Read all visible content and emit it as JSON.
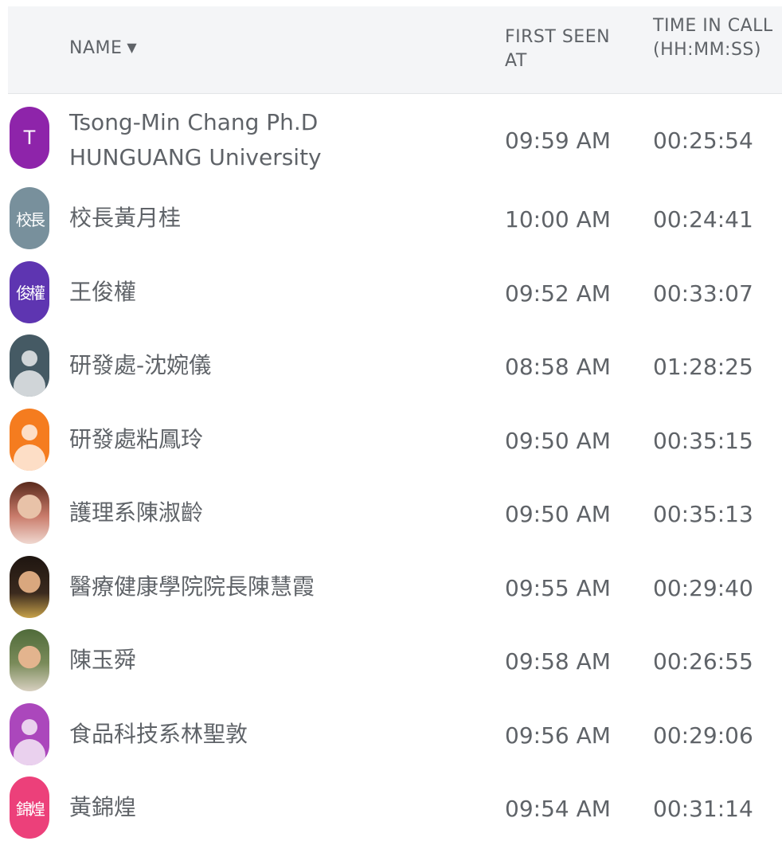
{
  "table": {
    "columns": {
      "name": "NAME",
      "name_sort_icon": "▼",
      "first_seen": "FIRST SEEN AT",
      "time_in_call": "TIME IN CALL (HH:MM:SS)"
    },
    "rows": [
      {
        "name_line1": "Tsong-Min Chang Ph.D",
        "name_line2": "HUNGUANG University",
        "avatar": {
          "type": "initials",
          "text": "T",
          "color": "#8e24aa"
        },
        "first_seen": "09:59 AM",
        "time_in_call": "00:25:54"
      },
      {
        "name": "校長黃月桂",
        "avatar": {
          "type": "initials",
          "text": "校長",
          "color": "#78909c"
        },
        "first_seen": "10:00 AM",
        "time_in_call": "00:24:41"
      },
      {
        "name": "王俊權",
        "avatar": {
          "type": "initials",
          "text": "俊權",
          "color": "#5e35b1"
        },
        "first_seen": "09:52 AM",
        "time_in_call": "00:33:07"
      },
      {
        "name": "研發處-沈婉儀",
        "avatar": {
          "type": "person-icon",
          "color": "#455a64"
        },
        "first_seen": "08:58 AM",
        "time_in_call": "01:28:25"
      },
      {
        "name": "研發處粘鳳玲",
        "avatar": {
          "type": "person-icon",
          "color": "#f57c1f"
        },
        "first_seen": "09:50 AM",
        "time_in_call": "00:35:15"
      },
      {
        "name": "護理系陳淑齡",
        "avatar": {
          "type": "photo",
          "color": "#c97b6a"
        },
        "first_seen": "09:50 AM",
        "time_in_call": "00:35:13"
      },
      {
        "name": "醫療健康學院院長陳慧霞",
        "avatar": {
          "type": "photo",
          "color": "#3b2a1e"
        },
        "first_seen": "09:55 AM",
        "time_in_call": "00:29:40"
      },
      {
        "name": "陳玉舜",
        "avatar": {
          "type": "photo",
          "color": "#7a8b5a"
        },
        "first_seen": "09:58 AM",
        "time_in_call": "00:26:55"
      },
      {
        "name": "食品科技系林聖敦",
        "avatar": {
          "type": "person-icon",
          "color": "#ab47bc"
        },
        "first_seen": "09:56 AM",
        "time_in_call": "00:29:06"
      },
      {
        "name": "黃錦煌",
        "avatar": {
          "type": "initials",
          "text": "錦煌",
          "color": "#ec407a"
        },
        "first_seen": "09:54 AM",
        "time_in_call": "00:31:14"
      }
    ]
  }
}
